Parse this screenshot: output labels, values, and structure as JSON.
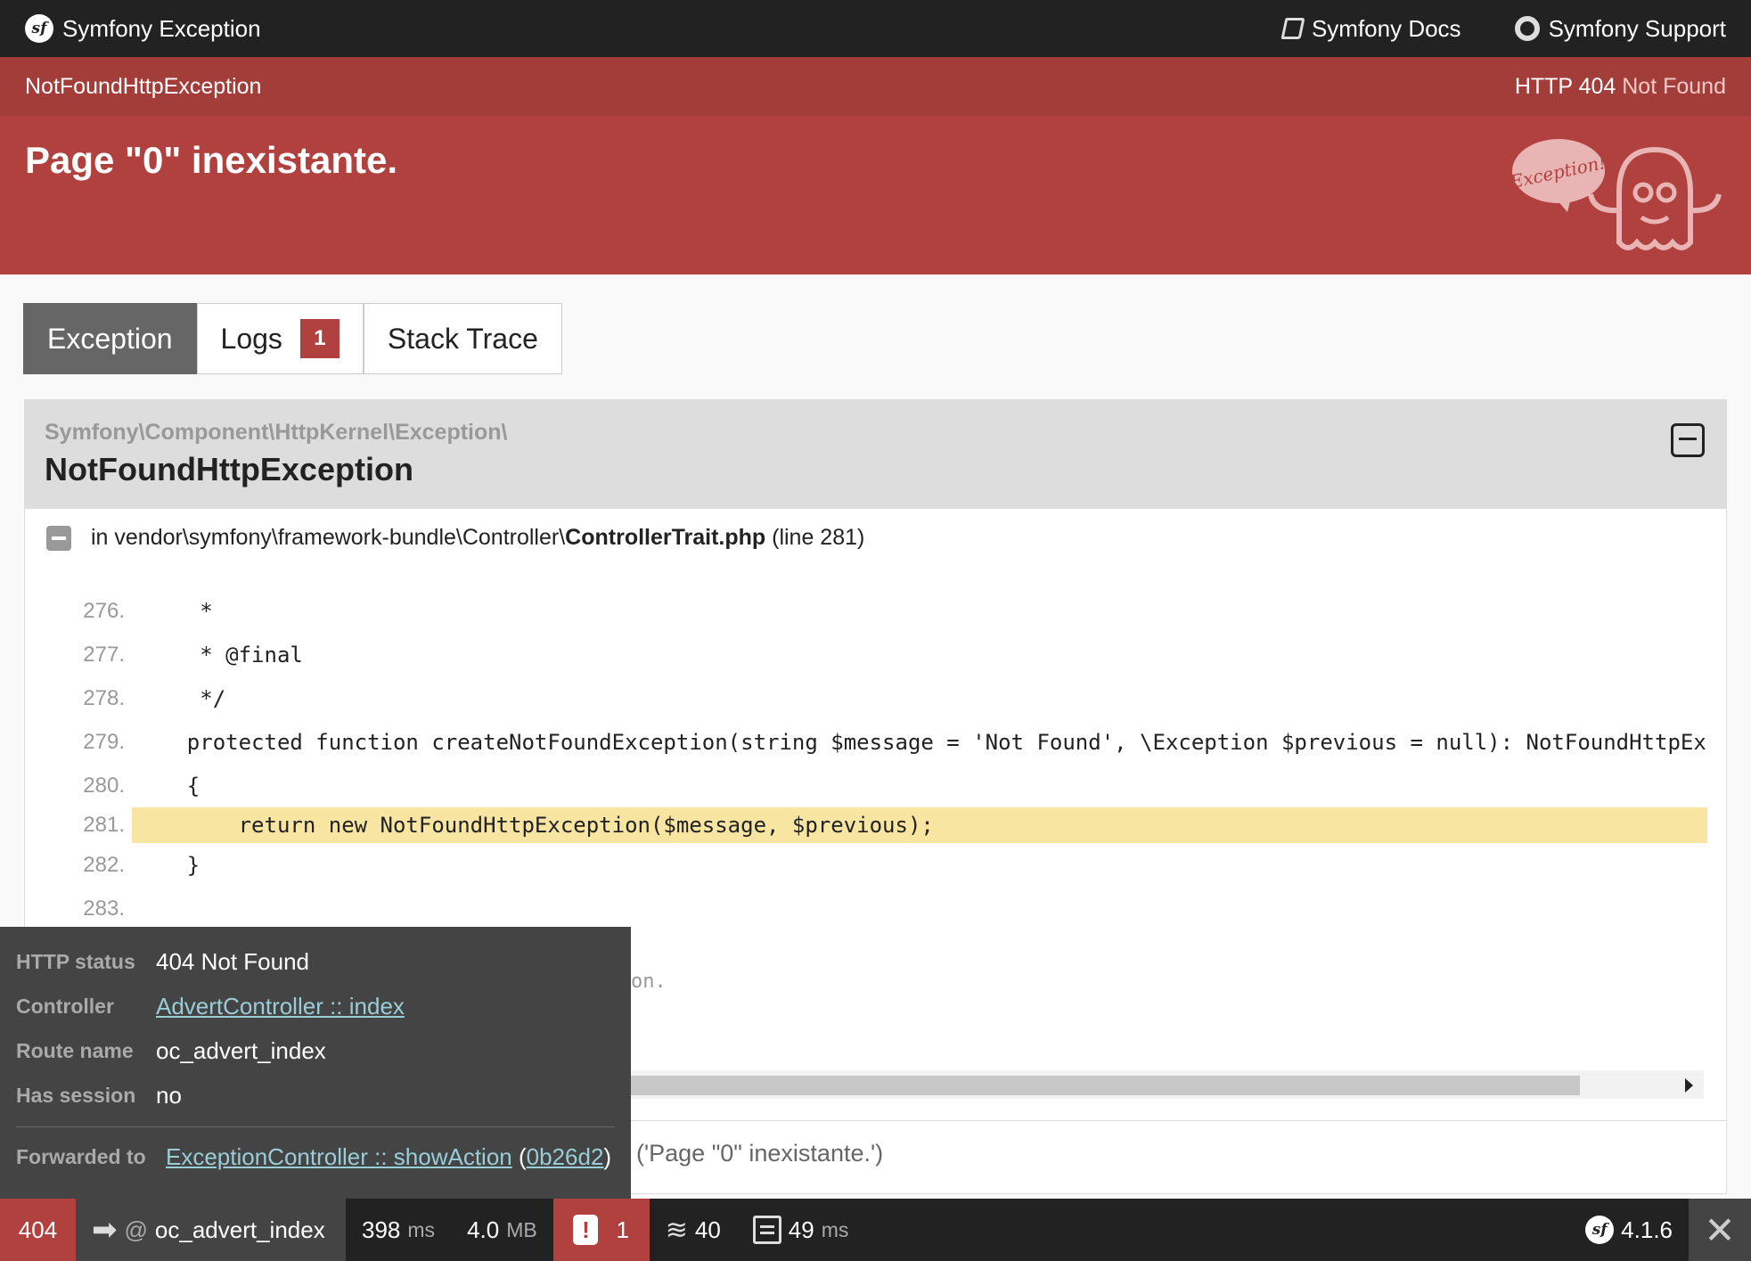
{
  "header": {
    "brand": "Symfony Exception",
    "docs_link": "Symfony Docs",
    "support_link": "Symfony Support"
  },
  "exception": {
    "class_short": "NotFoundHttpException",
    "status_code": "HTTP 404",
    "status_text": "Not Found",
    "message": "Page \"0\" inexistante.",
    "ghost_caption": "Exception!"
  },
  "tabs": [
    {
      "label": "Exception",
      "active": true
    },
    {
      "label": "Logs",
      "badge": "1"
    },
    {
      "label": "Stack Trace"
    }
  ],
  "trace": {
    "namespace": "Symfony\\Component\\HttpKernel\\Exception\\",
    "class": "NotFoundHttpException",
    "file_prefix": "in vendor\\symfony\\framework-bundle\\Controller\\",
    "file_name": "ControllerTrait.php",
    "file_line": "(line 281)",
    "code": [
      {
        "num": "276.",
        "text": "     *"
      },
      {
        "num": "277.",
        "text": "     * @final"
      },
      {
        "num": "278.",
        "text": "     */"
      },
      {
        "num": "279.",
        "text": "    protected function createNotFoundException(string $message = 'Not Found', \\Exception $previous = null): NotFoundHttpEx"
      },
      {
        "num": "280.",
        "text": "    {"
      },
      {
        "num": "281.",
        "text": "        return new NotFoundHttpException($message, $previous);"
      },
      {
        "num": "282.",
        "text": "    }"
      },
      {
        "num": "283.",
        "text": ""
      }
    ],
    "obscured_tail": "on.",
    "footer_call": "('Page \"0\" inexistante.')"
  },
  "popover": {
    "http_status_label": "HTTP status",
    "http_status_value": "404 Not Found",
    "controller_label": "Controller",
    "controller_value": "AdvertController :: index",
    "route_label": "Route name",
    "route_value": "oc_advert_index",
    "session_label": "Has session",
    "session_value": "no",
    "forwarded_label": "Forwarded to",
    "forwarded_value": "ExceptionController :: showAction",
    "forwarded_token": "0b26d2"
  },
  "toolbar": {
    "status": "404",
    "route_at": "@",
    "route": "oc_advert_index",
    "time_value": "398",
    "time_unit": "ms",
    "memory_value": "4.0",
    "memory_unit": "MB",
    "errors": "1",
    "layers": "40",
    "form_time": "49",
    "form_unit": "ms",
    "version": "4.1.6",
    "close": "✕"
  },
  "colors": {
    "accent": "#b0413e",
    "header_bg": "#222222",
    "highlight_line": "#f7e5a1",
    "link": "#99cdd8"
  }
}
